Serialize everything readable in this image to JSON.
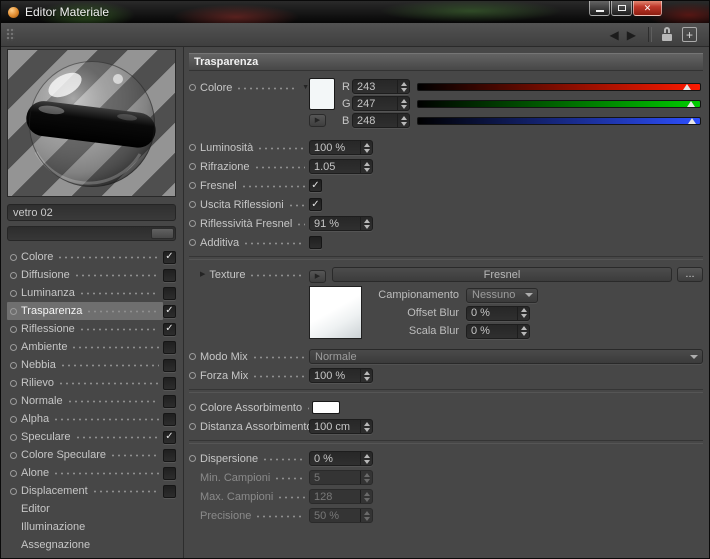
{
  "window": {
    "title": "Editor Materiale"
  },
  "icons": {
    "back": "◀",
    "forward": "▶",
    "expand_down": "▼",
    "expand_right": "▶",
    "plus": "+",
    "close": "✕"
  },
  "colors": {
    "transparency_color_swatch": "#f3f7f8",
    "absorption_color_swatch": "#ffffff",
    "slider_red_end": "#ff1a00",
    "slider_green_end": "#00cc00",
    "slider_blue_end": "#2d4fff",
    "selected_row_bg": "#6f6f6f",
    "close_button_red": "#c0392b"
  },
  "sidebar": {
    "material_name": "vetro 02",
    "channels": [
      {
        "label": "Colore",
        "check": "✓"
      },
      {
        "label": "Diffusione",
        "check": ""
      },
      {
        "label": "Luminanza",
        "check": ""
      },
      {
        "label": "Trasparenza",
        "check": "✓"
      },
      {
        "label": "Riflessione",
        "check": "✓"
      },
      {
        "label": "Ambiente",
        "check": ""
      },
      {
        "label": "Nebbia",
        "check": ""
      },
      {
        "label": "Rilievo",
        "check": ""
      },
      {
        "label": "Normale",
        "check": ""
      },
      {
        "label": "Alpha",
        "check": ""
      },
      {
        "label": "Speculare",
        "check": "✓"
      },
      {
        "label": "Colore Speculare",
        "check": ""
      },
      {
        "label": "Alone",
        "check": ""
      },
      {
        "label": "Displacement",
        "check": ""
      }
    ],
    "pages": [
      {
        "label": "Editor"
      },
      {
        "label": "Illuminazione"
      },
      {
        "label": "Assegnazione"
      }
    ]
  },
  "main": {
    "header": "Trasparenza",
    "colore_label": "Colore",
    "rgb": {
      "r_label": "R",
      "r_value": "243",
      "g_label": "G",
      "g_value": "247",
      "b_label": "B",
      "b_value": "248"
    },
    "luminosita": {
      "label": "Luminosità",
      "value": "100 %"
    },
    "rifrazione": {
      "label": "Rifrazione",
      "value": "1.05"
    },
    "fresnel": {
      "label": "Fresnel",
      "check": "✓"
    },
    "uscita_riflessioni": {
      "label": "Uscita Riflessioni",
      "check": "✓"
    },
    "riflessivita_fresnel": {
      "label": "Riflessività Fresnel",
      "value": "91 %"
    },
    "additiva": {
      "label": "Additiva",
      "check": ""
    },
    "texture": {
      "label": "Texture",
      "shader": "Fresnel",
      "browse": "...",
      "campionamento": {
        "label": "Campionamento",
        "value": "Nessuno"
      },
      "offset_blur": {
        "label": "Offset Blur",
        "value": "0 %"
      },
      "scala_blur": {
        "label": "Scala Blur",
        "value": "0 %"
      }
    },
    "modo_mix": {
      "label": "Modo Mix",
      "value": "Normale"
    },
    "forza_mix": {
      "label": "Forza Mix",
      "value": "100 %"
    },
    "colore_assorbimento": {
      "label": "Colore Assorbimento"
    },
    "distanza_assorbimento": {
      "label": "Distanza Assorbimento",
      "value": "100 cm"
    },
    "dispersione": {
      "label": "Dispersione",
      "value": "0 %"
    },
    "min_campioni": {
      "label": "Min. Campioni",
      "value": "5"
    },
    "max_campioni": {
      "label": "Max. Campioni",
      "value": "128"
    },
    "precisione": {
      "label": "Precisione",
      "value": "50 %"
    }
  }
}
